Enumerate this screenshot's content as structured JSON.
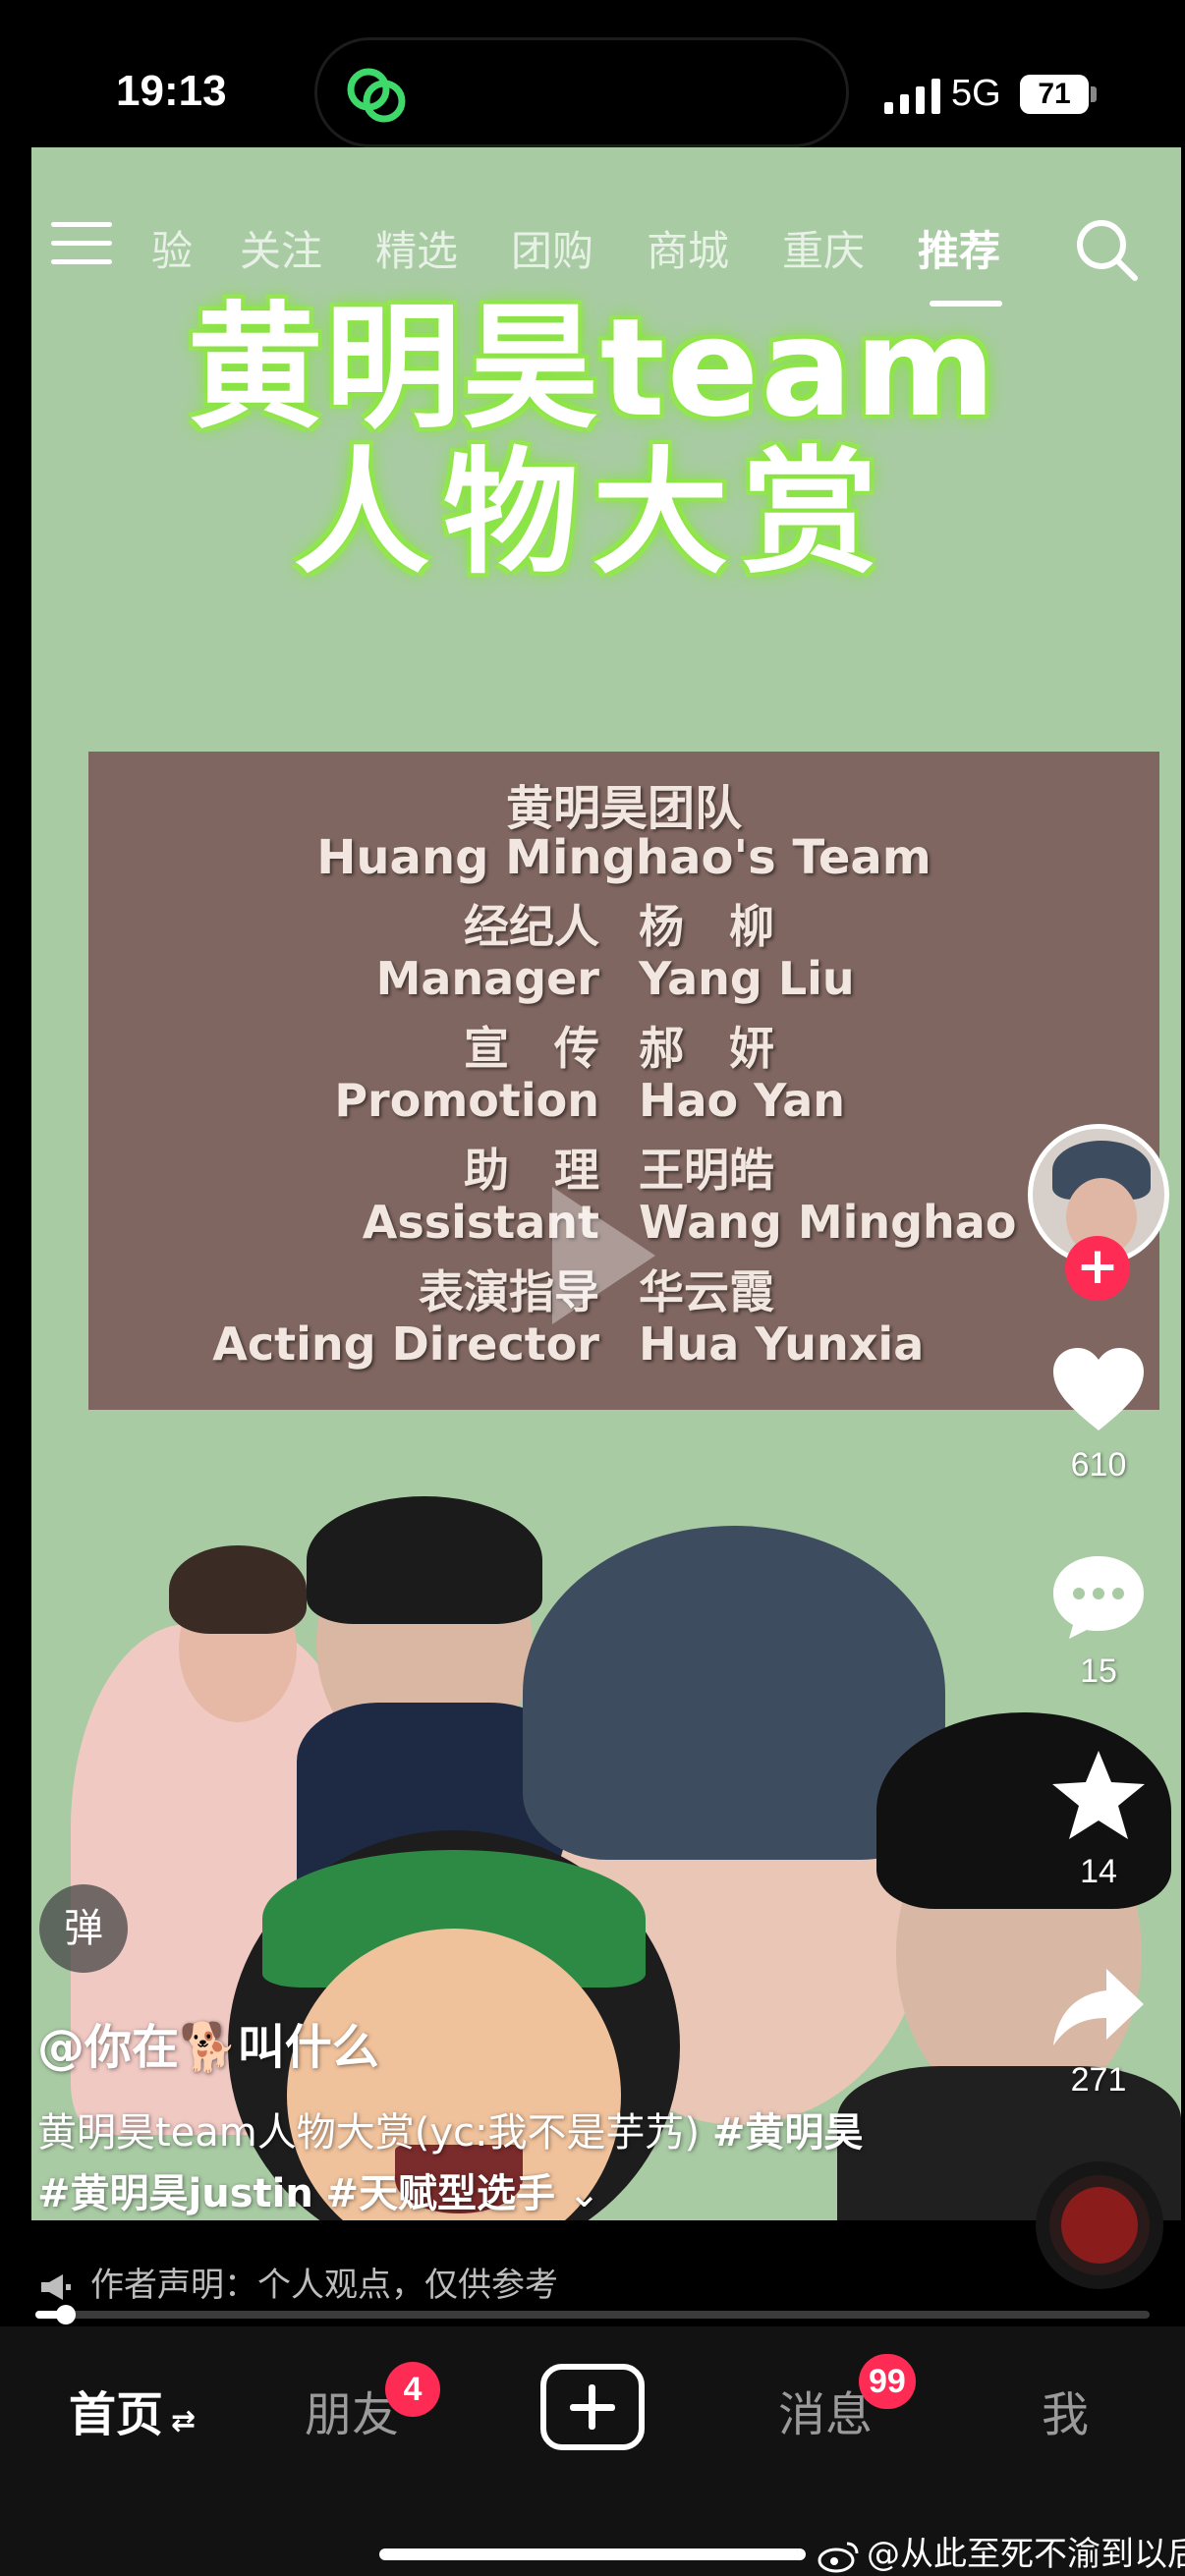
{
  "status_bar": {
    "time": "19:13",
    "network": "5G",
    "battery": "71"
  },
  "top_nav": {
    "tabs": [
      "验",
      "关注",
      "精选",
      "团购",
      "商城",
      "重庆",
      "推荐"
    ],
    "active_tab": "推荐"
  },
  "video": {
    "title_line1": "黄明昊team",
    "title_line2": "人物大赏",
    "credits": {
      "header_cn": "黄明昊团队",
      "header_en": "Huang Minghao's Team",
      "rows": [
        {
          "role": "经纪人",
          "name": "杨　柳"
        },
        {
          "role": "Manager",
          "name": "Yang Liu"
        },
        {
          "role": "宣　传",
          "name": "郝　妍"
        },
        {
          "role": "Promotion",
          "name": "Hao Yan"
        },
        {
          "role": "助　理",
          "name": "王明皓"
        },
        {
          "role": "Assistant",
          "name": "Wang Minghao"
        },
        {
          "role": "表演指导",
          "name": "华云霞"
        },
        {
          "role": "Acting Director",
          "name": "Hua Yunxia"
        }
      ]
    }
  },
  "side_actions": {
    "likes": "610",
    "comments": "15",
    "favorites": "14",
    "shares": "271"
  },
  "danmu_label": "弹",
  "author": "@你在🐕叫什么",
  "caption": {
    "text": "黄明昊team人物大赏(yc:我不是芋艿) ",
    "tags": [
      "#黄明昊",
      "#黄明昊justin",
      "#天赋型选手"
    ],
    "expand": "⌄"
  },
  "declaration": "作者声明：个人观点，仅供参考",
  "progress": {
    "fraction": 0.027
  },
  "bottom_nav": {
    "home": "首页",
    "home_icon": "⇄",
    "friends": "朋友",
    "friends_badge": "4",
    "messages": "消息",
    "messages_badge": "99",
    "me": "我"
  },
  "watermark": "@从此至死不渝到以后",
  "colors": {
    "accent": "#fe2c55",
    "video_bg": "#a9cba4",
    "title_glow": "#8fe04a"
  }
}
